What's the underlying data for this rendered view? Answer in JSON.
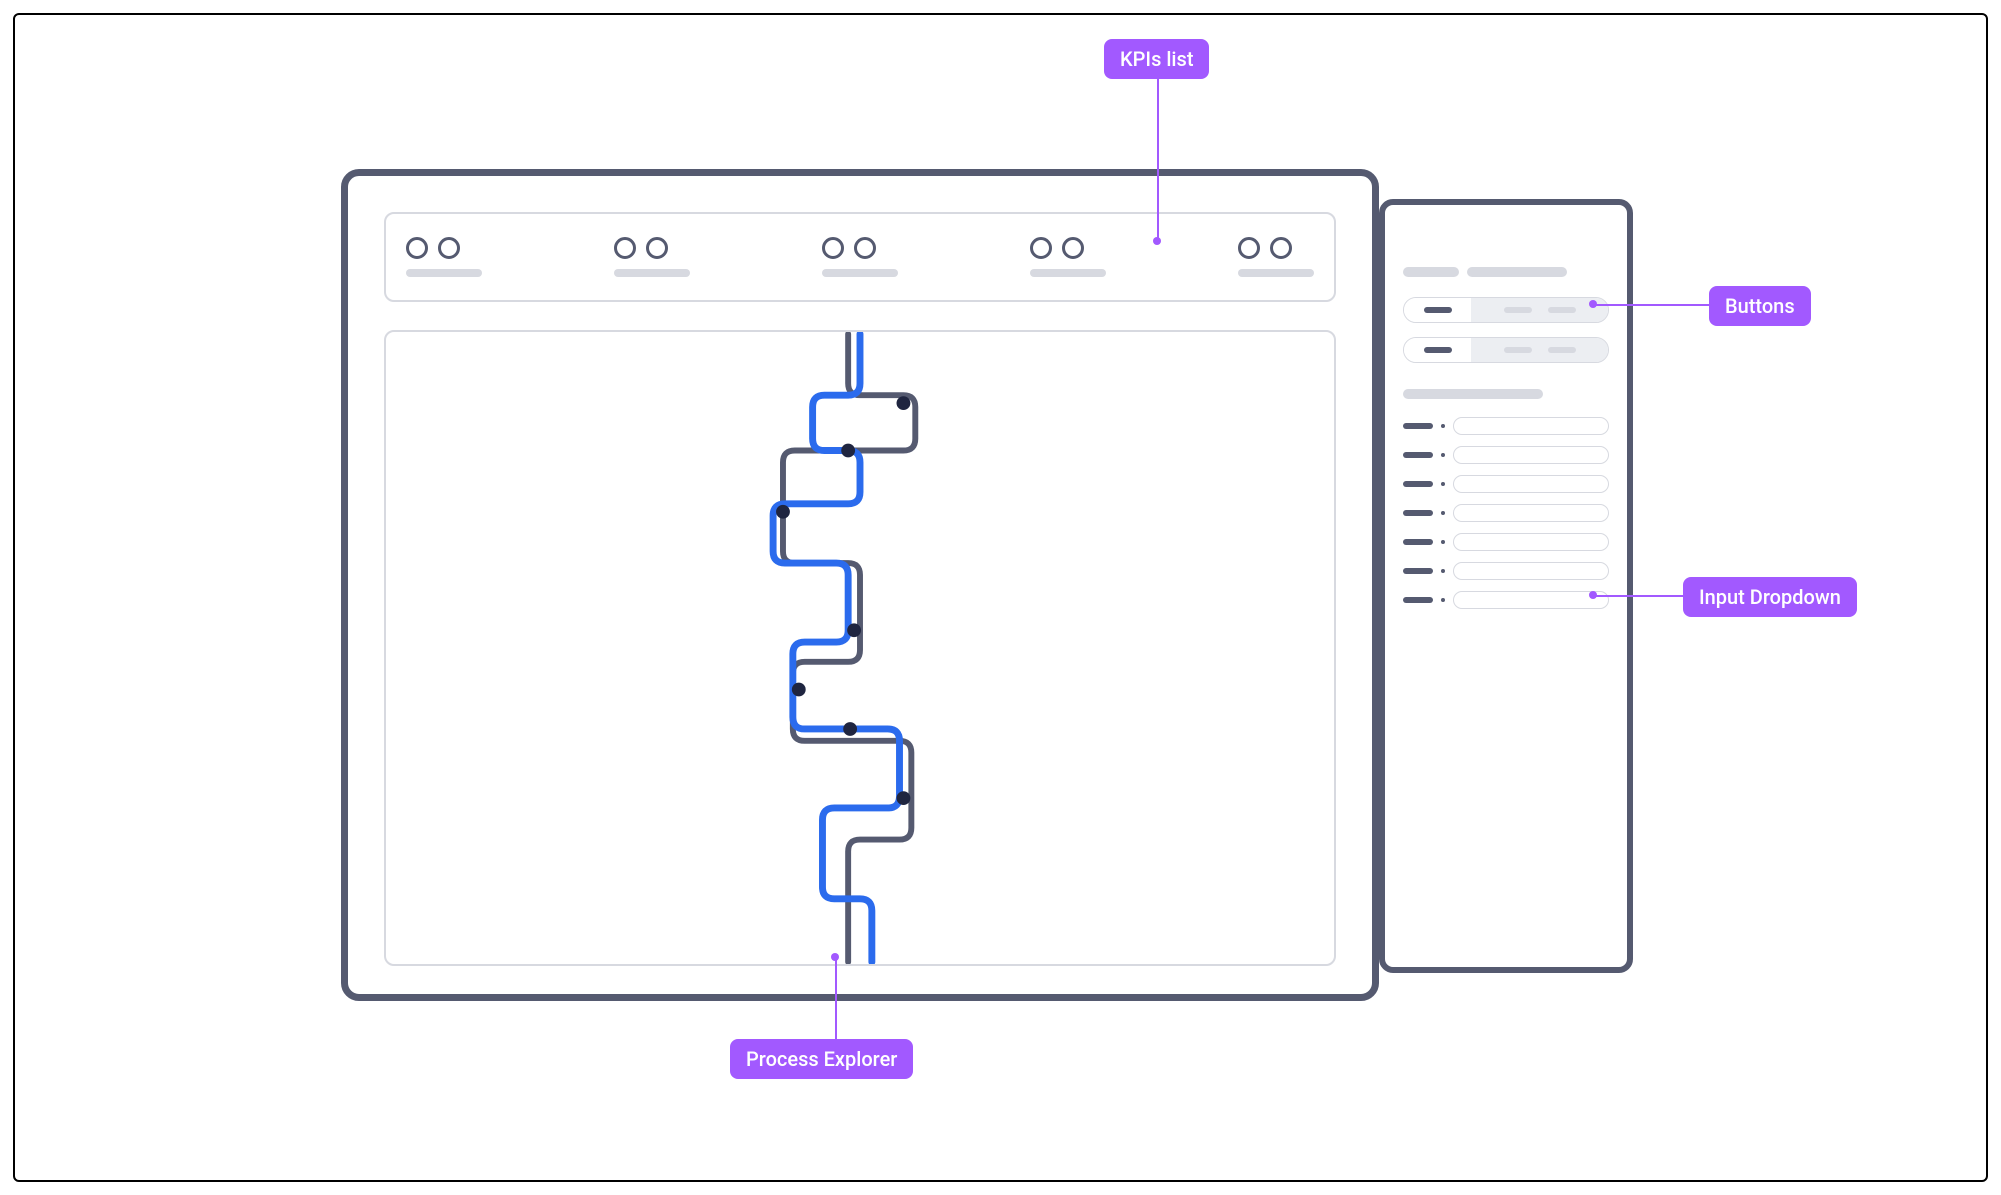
{
  "annotations": {
    "kpis": "KPIs list",
    "buttons": "Buttons",
    "dropdown": "Input Dropdown",
    "process": "Process Explorer"
  },
  "kpi_strip": {
    "cells": [
      {
        "circles": 2
      },
      {
        "circles": 2
      },
      {
        "circles": 2
      },
      {
        "circles": 2
      },
      {
        "circles": 2
      }
    ]
  },
  "side_panel": {
    "button_groups": [
      {
        "segments": 3
      },
      {
        "segments": 3
      }
    ],
    "input_rows": 7
  },
  "colors": {
    "accent": "#A259FF",
    "process_highlight": "#2B6BED",
    "process_base": "#555a70",
    "node": "#1f2540"
  }
}
